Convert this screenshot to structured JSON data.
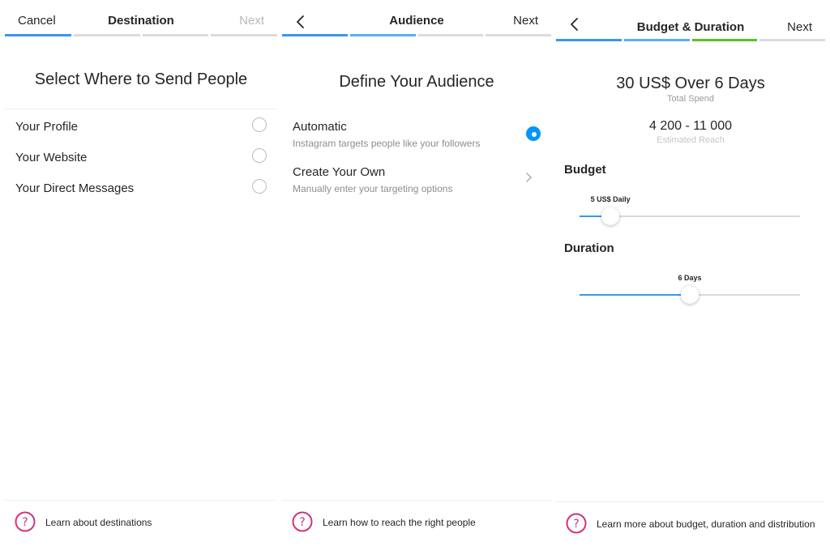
{
  "colors": {
    "accent": "#3897f0",
    "radio_on": "#0095f6",
    "progress_green": "#58c322",
    "help_gradient_start": "#c13584",
    "help_gradient_end": "#e1306c"
  },
  "destination": {
    "nav": {
      "left": "Cancel",
      "title": "Destination",
      "right": "Next"
    },
    "heading": "Select Where to Send People",
    "options": [
      {
        "label": "Your Profile",
        "selected": false
      },
      {
        "label": "Your Website",
        "selected": false
      },
      {
        "label": "Your Direct Messages",
        "selected": false
      }
    ],
    "footer": "Learn about destinations"
  },
  "audience": {
    "nav": {
      "back_icon": "chevron-left-icon",
      "title": "Audience",
      "right": "Next"
    },
    "heading": "Define Your Audience",
    "options": [
      {
        "label": "Automatic",
        "sub": "Instagram targets people like your followers",
        "selected": true
      },
      {
        "label": "Create Your Own",
        "sub": "Manually enter your targeting options"
      }
    ],
    "footer": "Learn how to reach the right people"
  },
  "budget": {
    "nav": {
      "back_icon": "chevron-left-icon",
      "title": "Budget & Duration",
      "right": "Next"
    },
    "total": "30 US$ Over 6 Days",
    "total_label": "Total Spend",
    "reach": "4 200 - 11 000",
    "reach_label": "Estimated Reach",
    "budget_label": "Budget",
    "budget_value": "5 US$ Daily",
    "budget_level": 0.14,
    "duration_label": "Duration",
    "duration_value": "6 Days",
    "duration_level": 0.5,
    "footer": "Learn more about budget, duration and distribution"
  }
}
